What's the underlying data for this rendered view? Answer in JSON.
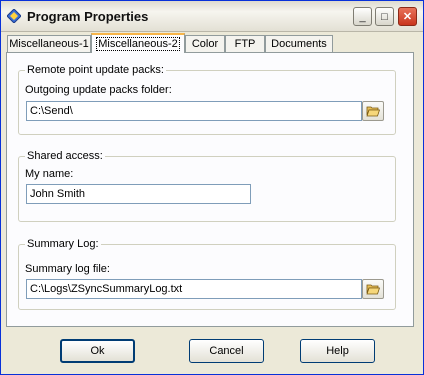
{
  "window": {
    "title": "Program Properties",
    "controls": {
      "minimize": "_",
      "maximize": "□",
      "close": "✕"
    }
  },
  "tabs": [
    {
      "label": "Miscellaneous-1",
      "active": false
    },
    {
      "label": "Miscellaneous-2",
      "active": true
    },
    {
      "label": "Color",
      "active": false
    },
    {
      "label": "FTP",
      "active": false
    },
    {
      "label": "Documents",
      "active": false
    }
  ],
  "remote": {
    "group_title": "Remote point update packs:",
    "folder_label": "Outgoing update packs folder:",
    "folder_value": "C:\\Send\\"
  },
  "shared": {
    "group_title": "Shared access:",
    "name_label": "My name:",
    "name_value": "John Smith"
  },
  "summary": {
    "group_title": "Summary Log:",
    "file_label": "Summary log file:",
    "file_value": "C:\\Logs\\ZSyncSummaryLog.txt"
  },
  "buttons": {
    "ok": "Ok",
    "cancel": "Cancel",
    "help": "Help"
  },
  "icons": {
    "app": "diamond-app-icon",
    "browse": "open-folder-icon"
  }
}
